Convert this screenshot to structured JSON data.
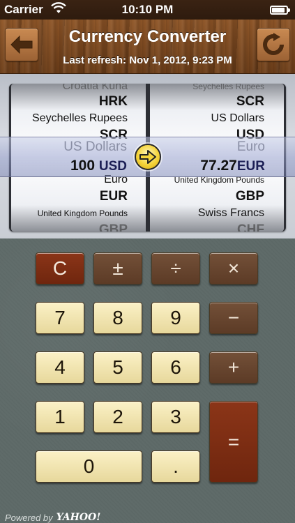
{
  "status_bar": {
    "carrier": "Carrier",
    "time": "10:10 PM",
    "battery_level": 0.92
  },
  "header": {
    "title": "Currency Converter",
    "last_refresh": "Last refresh: Nov 1, 2012, 9:23 PM",
    "back_icon": "arrow-left-icon",
    "refresh_icon": "refresh-icon"
  },
  "from_wheel": {
    "rows": [
      {
        "text": "Croatia Kuna",
        "style": "name fade"
      },
      {
        "text": "HRK",
        "style": "code"
      },
      {
        "text": "Seychelles Rupees",
        "style": "name"
      },
      {
        "text": "SCR",
        "style": "code"
      },
      {
        "text": "Euro",
        "style": "name"
      },
      {
        "text": "EUR",
        "style": "code"
      },
      {
        "text": "United Kingdom Pounds",
        "style": "name small"
      },
      {
        "text": "GBP",
        "style": "code fade"
      }
    ],
    "selected": {
      "name": "US Dollars",
      "amount": "100",
      "code": "USD"
    }
  },
  "to_wheel": {
    "rows": [
      {
        "text": "Seychelles Rupees",
        "style": "name small fade"
      },
      {
        "text": "SCR",
        "style": "code"
      },
      {
        "text": "US Dollars",
        "style": "name"
      },
      {
        "text": "USD",
        "style": "code"
      },
      {
        "text": "United Kingdom Pounds",
        "style": "name small"
      },
      {
        "text": "GBP",
        "style": "code"
      },
      {
        "text": "Swiss Francs",
        "style": "name"
      },
      {
        "text": "CHF",
        "style": "code fade"
      }
    ],
    "selected": {
      "name": "Euro",
      "amount": "77.27",
      "code": "EUR"
    }
  },
  "swap_icon": "arrow-right-circle-icon",
  "keypad": {
    "clear": "C",
    "plus_minus": "±",
    "divide": "÷",
    "multiply": "×",
    "subtract": "−",
    "add": "+",
    "equals": "=",
    "decimal": ".",
    "digits": [
      "0",
      "1",
      "2",
      "3",
      "4",
      "5",
      "6",
      "7",
      "8",
      "9"
    ]
  },
  "footer": {
    "powered_by": "Powered by",
    "provider": "YAHOO!"
  },
  "colors": {
    "wood": "#7a4720",
    "keypad_bg": "#5f6b69",
    "cream_key": "#f2e5b0",
    "brown_key": "#674530",
    "red_key": "#7e2e13",
    "highlight_arrow": "#f5d43a"
  }
}
